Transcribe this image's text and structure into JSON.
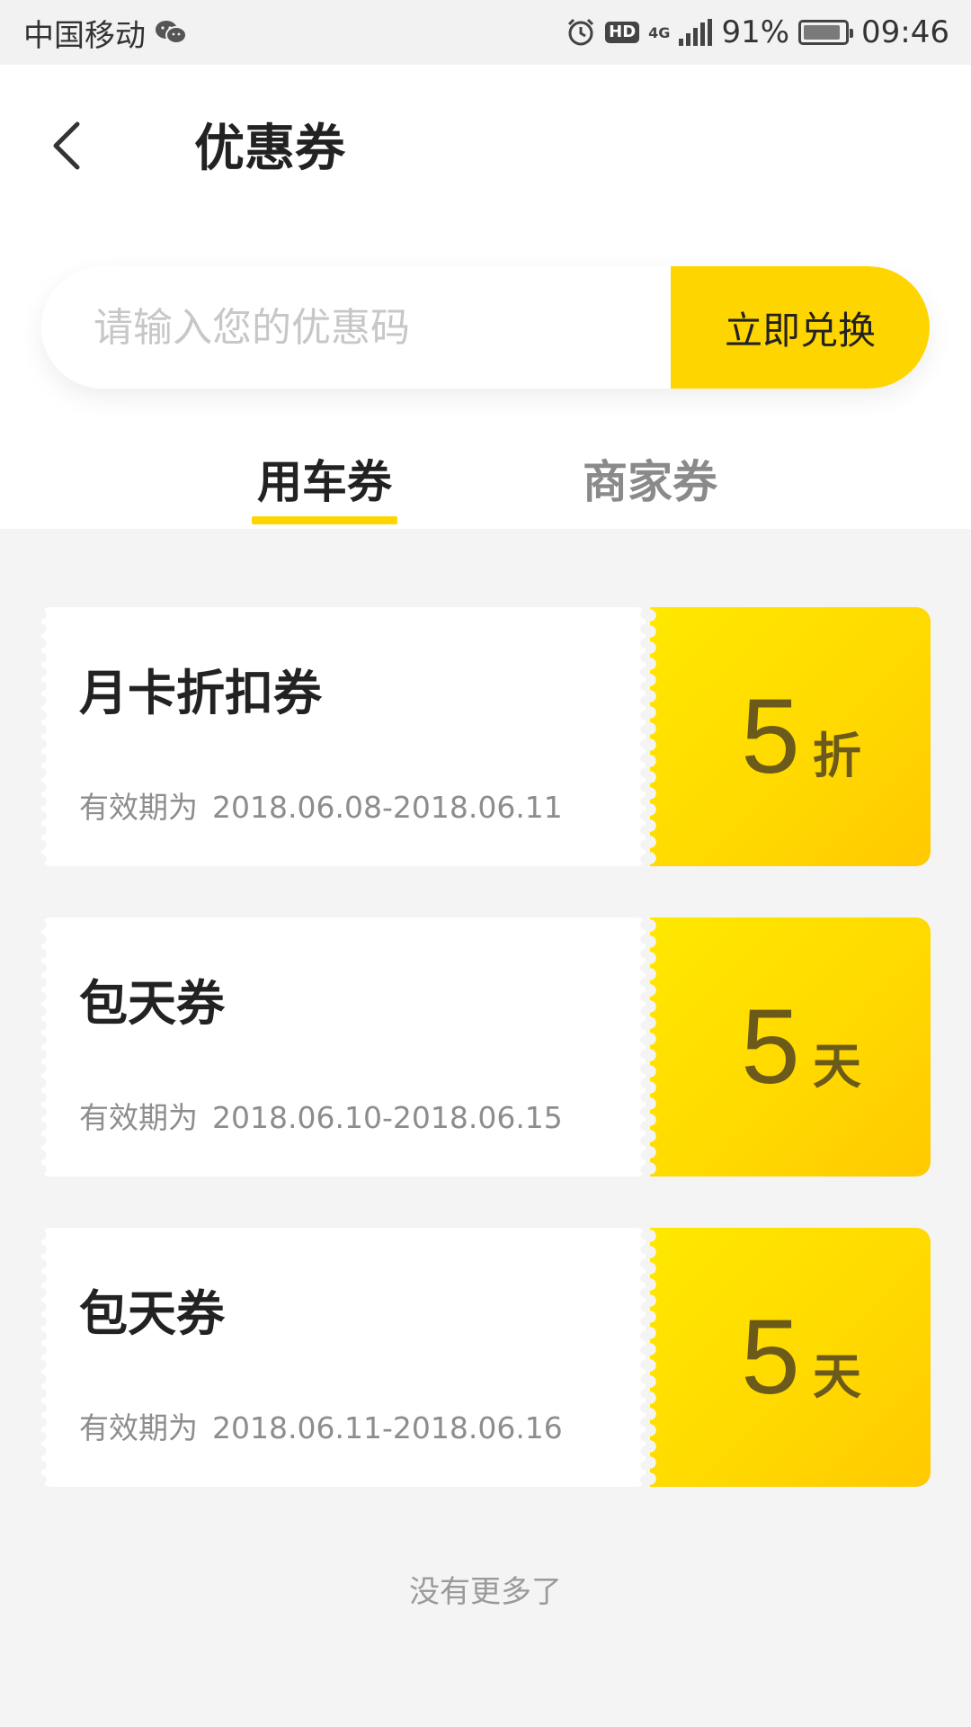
{
  "status_bar": {
    "carrier": "中国移动",
    "network": "4G",
    "battery": "91%",
    "time": "09:46",
    "icons": [
      "wechat-icon",
      "alarm-icon",
      "hd-icon",
      "signal-icon",
      "battery-icon"
    ]
  },
  "header": {
    "title": "优惠券",
    "back_icon": "chevron-left-icon"
  },
  "redeem": {
    "placeholder": "请输入您的优惠码",
    "button_label": "立即兑换"
  },
  "tabs": [
    {
      "label": "用车券",
      "active": true
    },
    {
      "label": "商家券",
      "active": false
    }
  ],
  "coupons": [
    {
      "name": "月卡折扣券",
      "validity_prefix": "有效期为",
      "validity_range": "2018.06.08-2018.06.11",
      "value": "5",
      "unit": "折"
    },
    {
      "name": "包天券",
      "validity_prefix": "有效期为",
      "validity_range": "2018.06.10-2018.06.15",
      "value": "5",
      "unit": "天"
    },
    {
      "name": "包天券",
      "validity_prefix": "有效期为",
      "validity_range": "2018.06.11-2018.06.16",
      "value": "5",
      "unit": "天"
    }
  ],
  "footer": {
    "no_more": "没有更多了"
  },
  "colors": {
    "accent": "#ffd500",
    "background": "#f4f4f4"
  }
}
